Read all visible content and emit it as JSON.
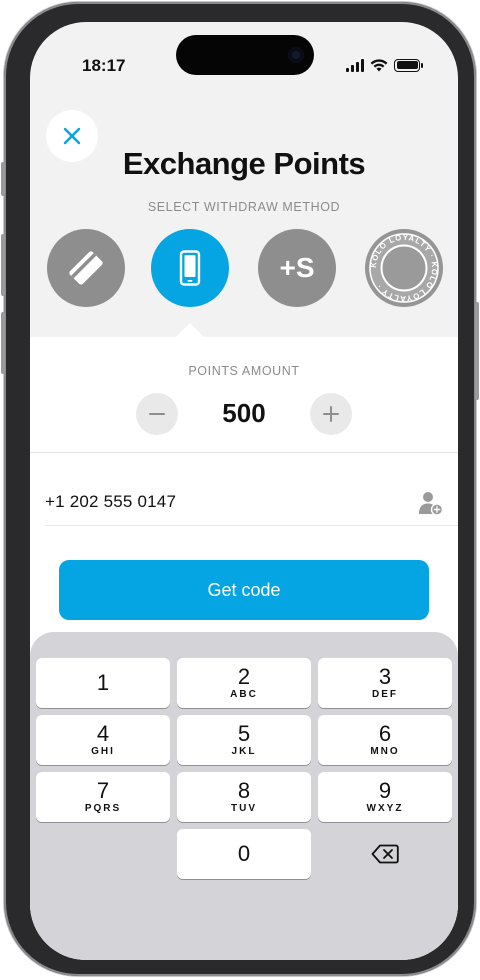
{
  "status_bar": {
    "time": "18:17"
  },
  "header": {
    "title": "Exchange Points",
    "method_label": "SELECT WITHDRAW METHOD",
    "methods": [
      {
        "id": "card",
        "icon": "card-icon",
        "selected": false
      },
      {
        "id": "mobile",
        "icon": "smartphone-icon",
        "selected": true
      },
      {
        "id": "plus-s",
        "icon": "plus-s-logo",
        "label": "+S",
        "selected": false
      },
      {
        "id": "kolo",
        "icon": "kolo-loyalty-seal",
        "seal_text": "KOLO LOYALTY · KOLO LOYALTY ·",
        "selected": false
      }
    ]
  },
  "points": {
    "label": "POINTS AMOUNT",
    "minus": "−",
    "plus": "+",
    "value": "500"
  },
  "phone_field": {
    "value": "+1 202 555 0147",
    "contact_icon": "contact-add-icon"
  },
  "action": {
    "get_code_label": "Get code"
  },
  "keypad": {
    "keys": [
      {
        "num": "1",
        "letters": ""
      },
      {
        "num": "2",
        "letters": "ABC"
      },
      {
        "num": "3",
        "letters": "DEF"
      },
      {
        "num": "4",
        "letters": "GHI"
      },
      {
        "num": "5",
        "letters": "JKL"
      },
      {
        "num": "6",
        "letters": "MNO"
      },
      {
        "num": "7",
        "letters": "PQRS"
      },
      {
        "num": "8",
        "letters": "TUV"
      },
      {
        "num": "9",
        "letters": "WXYZ"
      },
      {
        "num": "0",
        "letters": ""
      }
    ],
    "delete_icon": "backspace-icon"
  },
  "colors": {
    "accent": "#04a5e2",
    "method_grey": "#8e8e8e",
    "keypad_bg": "#d3d3d8",
    "screen_bg": "#f2f2f2"
  }
}
